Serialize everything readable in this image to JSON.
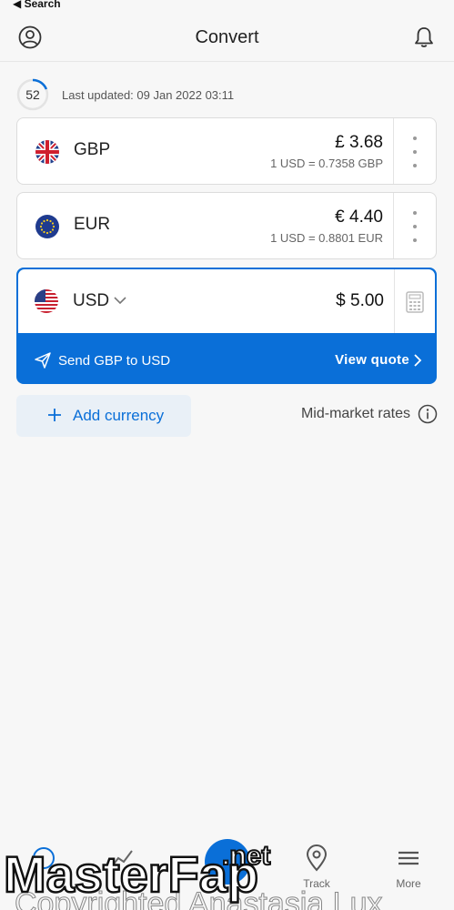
{
  "status": {
    "back_label": "◀ Search"
  },
  "header": {
    "title": "Convert"
  },
  "updated": {
    "countdown": "52",
    "text": "Last updated: 09 Jan 2022 03:11",
    "progress": 0.15
  },
  "currencies": [
    {
      "code": "GBP",
      "amount": "£ 3.68",
      "rate": "1 USD = 0.7358 GBP"
    },
    {
      "code": "EUR",
      "amount": "€ 4.40",
      "rate": "1 USD = 0.8801 EUR"
    }
  ],
  "base": {
    "code": "USD",
    "amount": "$ 5.00"
  },
  "send": {
    "label": "Send GBP to USD",
    "quote": "View quote"
  },
  "add_currency": {
    "label": "Add currency"
  },
  "mid_market": {
    "label": "Mid-market rates"
  },
  "tabbar": {
    "items": [
      "Track",
      "More"
    ]
  },
  "watermark": {
    "brand": "MasterFap",
    "suffix": ".net",
    "notice": "Copyrighted Anastasia Lux"
  },
  "colors": {
    "accent": "#0a6fd8",
    "background": "#f7f7f7",
    "watermark_pink": "#e0218a"
  }
}
